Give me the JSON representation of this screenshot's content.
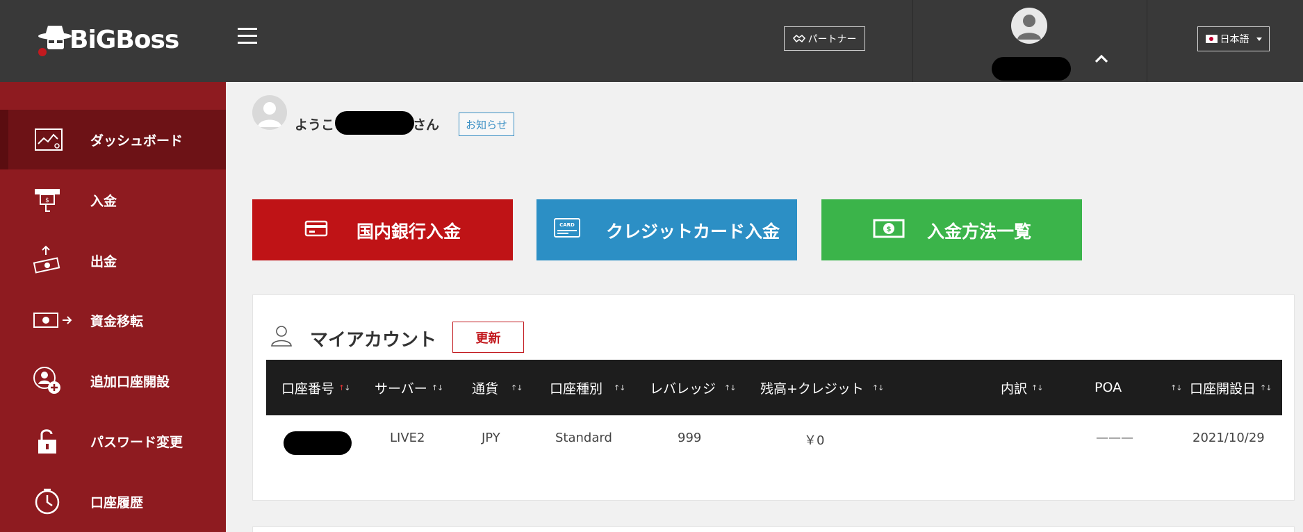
{
  "header": {
    "logo_text": "BiGBoss",
    "partner_label": "パートナー",
    "language_label": "日本語"
  },
  "sidebar": {
    "items": [
      {
        "label": "ダッシュボード",
        "icon": "dashboard-chart-icon",
        "active": true
      },
      {
        "label": "入金",
        "icon": "atm-deposit-icon"
      },
      {
        "label": "出金",
        "icon": "cash-withdraw-icon"
      },
      {
        "label": "資金移転",
        "icon": "money-transfer-icon"
      },
      {
        "label": "追加口座開設",
        "icon": "add-account-icon"
      },
      {
        "label": "パスワード変更",
        "icon": "unlock-icon"
      },
      {
        "label": "口座履歴",
        "icon": "history-clock-icon"
      }
    ]
  },
  "welcome": {
    "prefix": "ようこ",
    "suffix": "さん",
    "notice_label": "お知らせ"
  },
  "actions": {
    "bank": "国内銀行入金",
    "card": "クレジットカード入金",
    "methods": "入金方法一覧",
    "card_icon_text": "CARD"
  },
  "account": {
    "title": "マイアカウント",
    "refresh_label": "更新",
    "columns": [
      "口座番号",
      "サーバー",
      "通貨",
      "口座種別",
      "レバレッジ",
      "残高+クレジット",
      "内訳",
      "POA",
      "口座開設日"
    ],
    "rows": [
      {
        "server": "LIVE2",
        "currency": "JPY",
        "type": "Standard",
        "leverage": "999",
        "balance": "￥0",
        "poa": "———",
        "opened": "2021/10/29"
      }
    ]
  },
  "colors": {
    "header_bg": "#393939",
    "sidebar_bg": "#8e1b20",
    "bank_btn": "#bf1316",
    "card_btn": "#2c8fc5",
    "methods_btn": "#3bb44a",
    "accent_red": "#c21a1f"
  }
}
